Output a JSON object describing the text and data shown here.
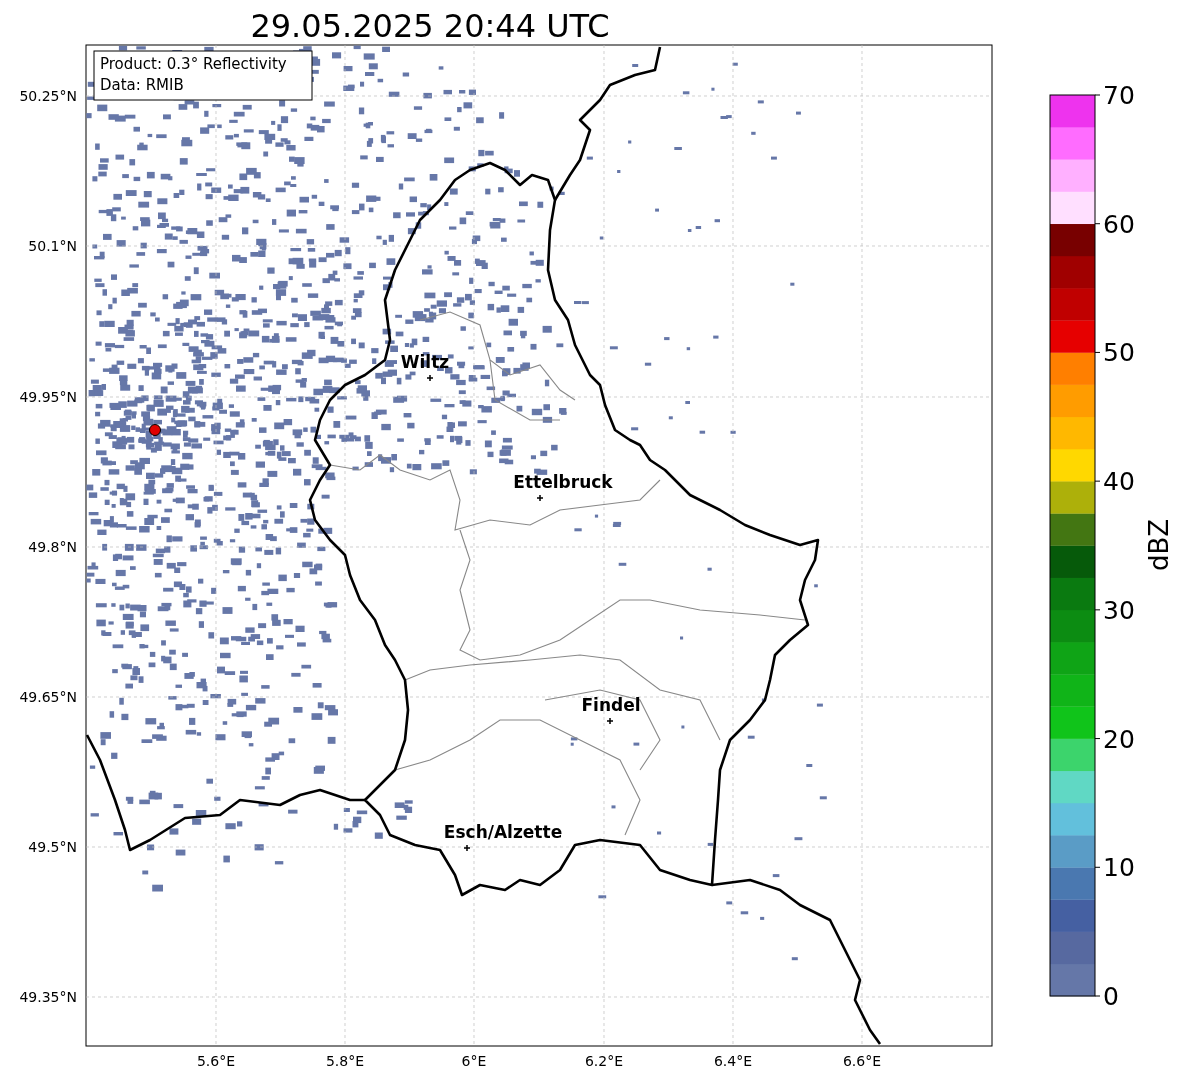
{
  "title": "29.05.2025 20:44 UTC",
  "info_box": [
    "Product: 0.3° Reflectivity",
    "Data: RMIB"
  ],
  "map": {
    "lat_ticks": [
      "50.25°N",
      "50.1°N",
      "49.95°N",
      "49.8°N",
      "49.65°N",
      "49.5°N",
      "49.35°N"
    ],
    "lon_ticks": [
      "5.6°E",
      "5.8°E",
      "6°E",
      "6.2°E",
      "6.4°E",
      "6.6°E"
    ],
    "cities": [
      {
        "label": "Wiltz"
      },
      {
        "label": "Ettelbruck"
      },
      {
        "label": "Findel"
      },
      {
        "label": "Esch/Alzette"
      }
    ]
  },
  "colorbar": {
    "label": "dBZ",
    "ticks": [
      "70",
      "60",
      "50",
      "40",
      "30",
      "20",
      "10",
      "0"
    ],
    "bands": [
      {
        "color": "#6577a8"
      },
      {
        "color": "#5769a0"
      },
      {
        "color": "#4560a2"
      },
      {
        "color": "#4a78b0"
      },
      {
        "color": "#5a9cc6"
      },
      {
        "color": "#62c0dc"
      },
      {
        "color": "#60d8c4"
      },
      {
        "color": "#3cd46c"
      },
      {
        "color": "#10c41a"
      },
      {
        "color": "#10b418"
      },
      {
        "color": "#0fa416"
      },
      {
        "color": "#0c8c12"
      },
      {
        "color": "#0a7a10"
      },
      {
        "color": "#065a0a"
      },
      {
        "color": "#437612"
      },
      {
        "color": "#adb00a"
      },
      {
        "color": "#ffd800"
      },
      {
        "color": "#ffb800"
      },
      {
        "color": "#ff9c00"
      },
      {
        "color": "#ff7f00"
      },
      {
        "color": "#e60000"
      },
      {
        "color": "#c00000"
      },
      {
        "color": "#a00000"
      },
      {
        "color": "#780000"
      },
      {
        "color": "#ffdfff"
      },
      {
        "color": "#ffb0ff"
      },
      {
        "color": "#ff6cff"
      },
      {
        "color": "#ee33ee"
      }
    ]
  }
}
